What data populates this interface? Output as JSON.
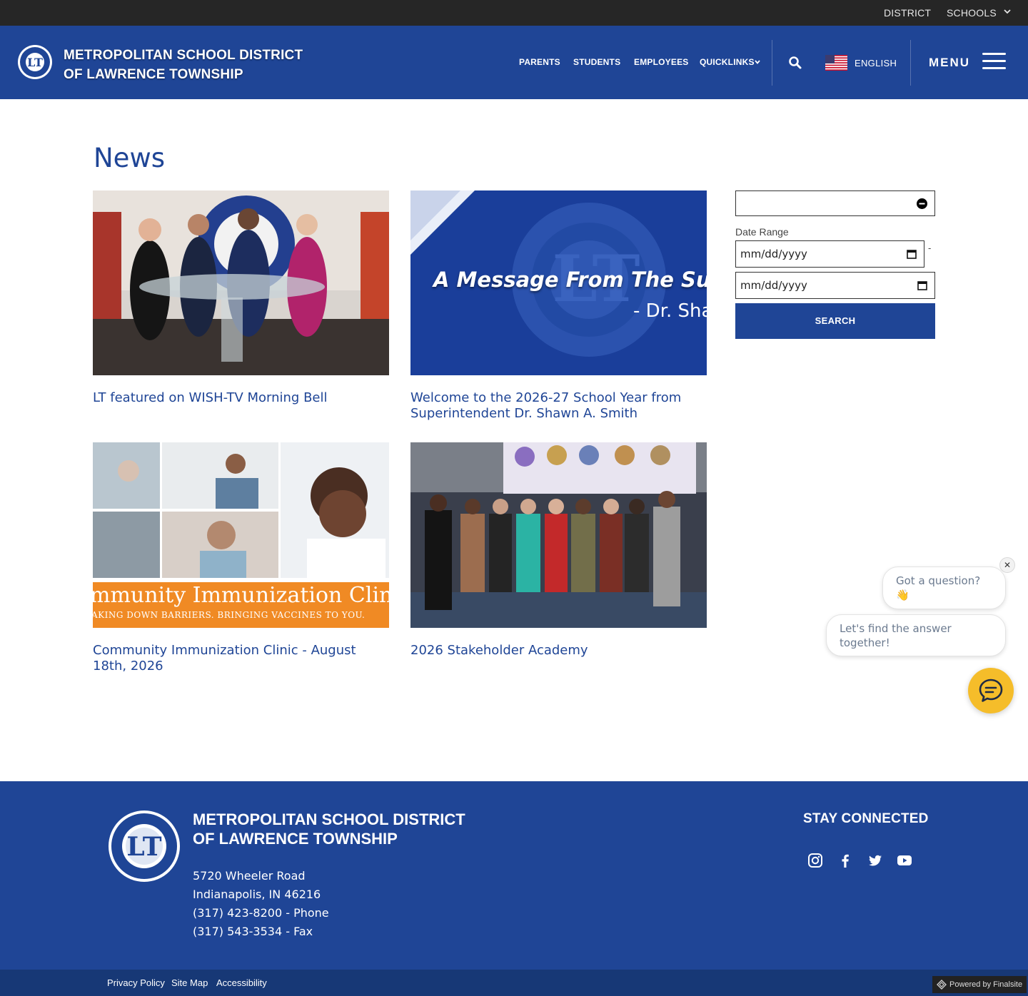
{
  "topbar": {
    "district": "DISTRICT",
    "schools": "SCHOOLS"
  },
  "header": {
    "name_line1": "METROPOLITAN SCHOOL DISTRICT",
    "name_line2": "OF LAWRENCE TOWNSHIP",
    "logo_letters": "LT",
    "nav": [
      "PARENTS",
      "STUDENTS",
      "EMPLOYEES",
      "QUICKLINKS"
    ],
    "language": "ENGLISH",
    "menu": "MENU"
  },
  "main": {
    "title": "News",
    "articles": [
      {
        "title": "LT featured on WISH-TV Morning Bell",
        "image": "tv-studio-photo"
      },
      {
        "title": "Welcome to the 2026-27 School Year from Superintendent Dr. Shawn A. Smith",
        "image": "superintendent-message-graphic",
        "image_text": "A Message From The Super",
        "image_subtext": "- Dr. Sha"
      },
      {
        "title": "Community Immunization Clinic - August 18th, 2026",
        "image": "immunization-collage",
        "image_text": "mmunity Immunization Clin",
        "image_subtext": "AKING DOWN BARRIERS. BRINGING VACCINES TO YOU."
      },
      {
        "title": "2026 Stakeholder Academy",
        "image": "group-photo"
      }
    ]
  },
  "filter": {
    "date_range_label": "Date Range",
    "start_placeholder": "mm/dd/yyyy",
    "end_placeholder": "mm/dd/yyyy",
    "separator": "-",
    "search_button": "SEARCH"
  },
  "chat": {
    "bubble1": "Got a question? 👋",
    "bubble2": "Let's find the answer together!",
    "close": "✕"
  },
  "footer": {
    "name_line1": "METROPOLITAN SCHOOL DISTRICT",
    "name_line2": "OF LAWRENCE TOWNSHIP",
    "address1": "5720 Wheeler Road",
    "address2": "Indianapolis, IN  46216",
    "phone": "(317) 423-8200 - Phone",
    "fax": "(317) 543-3534 - Fax",
    "stay_connected": "STAY CONNECTED",
    "social": [
      "instagram-icon",
      "facebook-icon",
      "twitter-icon",
      "youtube-icon"
    ],
    "links": [
      "Privacy Policy",
      "Site Map",
      "Accessibility"
    ],
    "powered_by": "Powered by Finalsite"
  },
  "colors": {
    "brand_blue": "#1f4596",
    "topbar": "#262626",
    "chat_yellow": "#f5bd2a"
  }
}
